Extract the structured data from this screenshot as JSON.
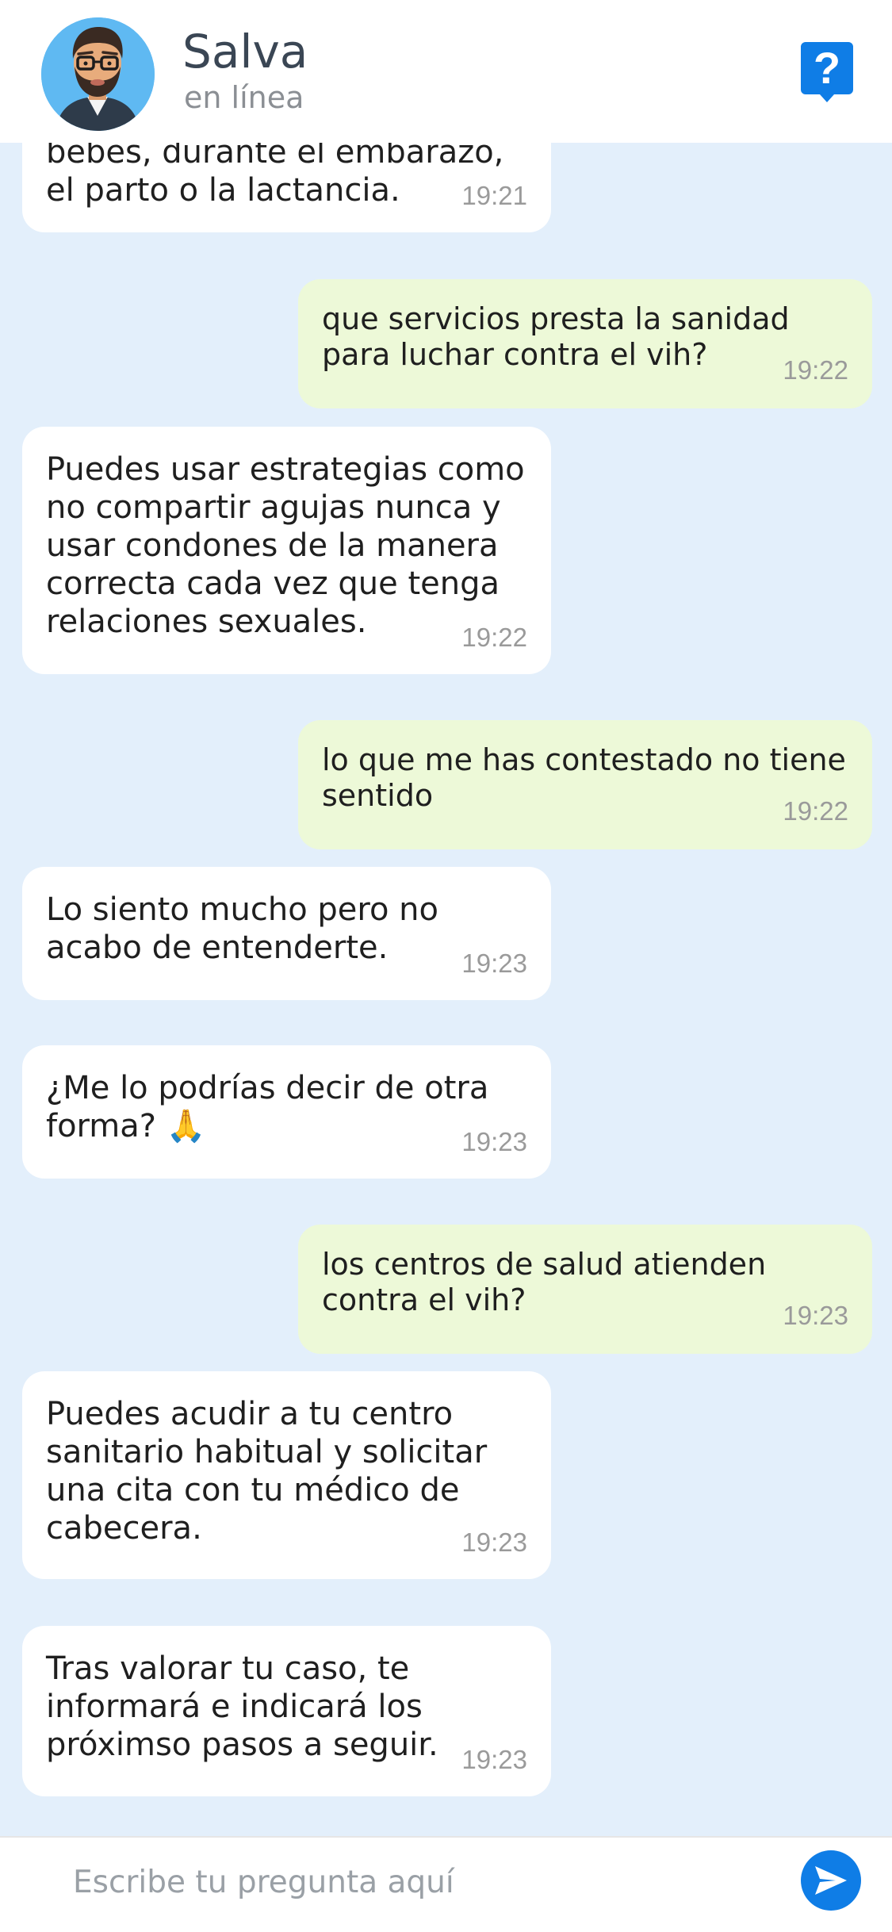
{
  "header": {
    "contact_name": "Salva",
    "status": "en línea",
    "help_label": "?"
  },
  "messages": [
    {
      "sender": "bot",
      "text": "bebes, durante el embarazo, el parto o la lactancia.",
      "time": "19:21"
    },
    {
      "sender": "user",
      "text": "que servicios presta la sanidad para luchar contra el vih?",
      "time": "19:22"
    },
    {
      "sender": "bot",
      "text": "Puedes usar estrategias como no compartir agujas nunca y usar condones de la manera correcta cada vez que tenga relaciones sexuales.",
      "time": "19:22"
    },
    {
      "sender": "user",
      "text": "lo que me has contestado no tiene sentido",
      "time": "19:22"
    },
    {
      "sender": "bot",
      "text": "Lo siento mucho pero no acabo de entenderte.",
      "time": "19:23"
    },
    {
      "sender": "bot",
      "text": "¿Me lo podrías decir de otra forma? 🙏",
      "time": "19:23"
    },
    {
      "sender": "user",
      "text": "los centros de salud atienden contra el vih?",
      "time": "19:23"
    },
    {
      "sender": "bot",
      "text": "Puedes acudir a tu centro sanitario habitual y solicitar una cita con tu médico de cabecera.",
      "time": "19:23"
    },
    {
      "sender": "bot",
      "text": "Tras valorar tu caso, te informará e indicará los próximso pasos a seguir.",
      "time": "19:23"
    }
  ],
  "composer": {
    "placeholder": "Escribe tu pregunta aquí"
  },
  "colors": {
    "background": "#e3effb",
    "bot_bubble": "#ffffff",
    "user_bubble": "#edf9d8",
    "accent": "#0f7de6"
  }
}
